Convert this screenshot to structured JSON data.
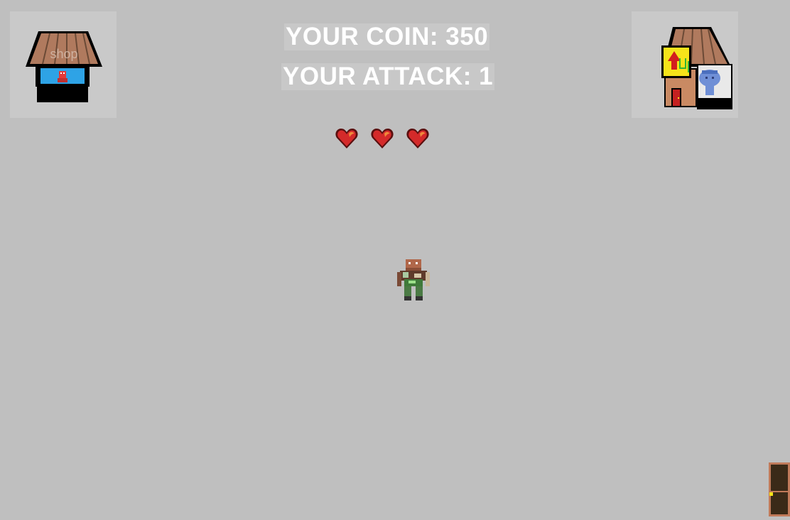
{
  "hud": {
    "coin_text": "YOUR COIN: 350",
    "attack_text": "YOUR ATTACK: 1",
    "coin": 350,
    "attack": 1
  },
  "lives": {
    "count": 3,
    "icon": "heart-icon",
    "color": "#d42a2a"
  },
  "buildings": {
    "shop": {
      "sign_text": "shop",
      "icon": "shop-building-icon"
    },
    "upgrade": {
      "icon": "upgrade-building-icon"
    }
  },
  "player": {
    "icon": "player-sprite"
  },
  "exit": {
    "icon": "exit-door-icon",
    "color": "#3a2a18"
  },
  "colors": {
    "background": "#bfbfbf",
    "roof": "#b07a5e",
    "shop_window": "#2ea3e6",
    "upgrade_sign": "#f5e31a"
  }
}
